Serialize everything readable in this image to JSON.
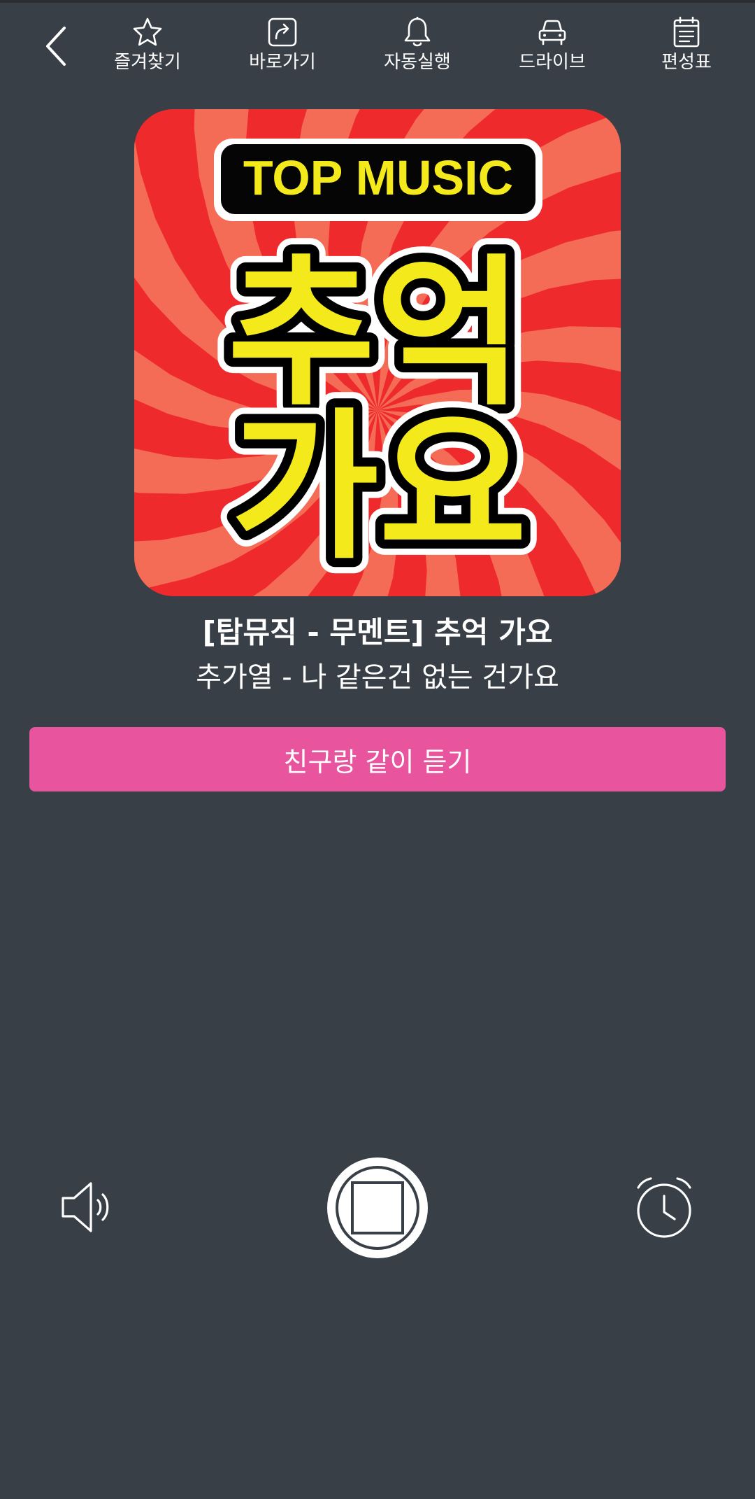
{
  "toolbar": {
    "back_icon": "chevron-left-icon",
    "items": [
      {
        "label": "즐겨찾기",
        "icon": "star-icon"
      },
      {
        "label": "바로가기",
        "icon": "share-arrow-icon"
      },
      {
        "label": "자동실행",
        "icon": "bell-icon"
      },
      {
        "label": "드라이브",
        "icon": "car-icon"
      },
      {
        "label": "편성표",
        "icon": "calendar-list-icon"
      }
    ]
  },
  "album": {
    "badge_text": "TOP MUSIC",
    "line1": "추억",
    "line2": "가요",
    "colors": {
      "red": "#ee2a2c",
      "salmon": "#f4775e",
      "yellow": "#f4ea1b"
    }
  },
  "now_playing": {
    "program_title": "[탑뮤직 - 무멘트] 추억 가요",
    "song_title": "추가열 - 나 같은건 없는 건가요"
  },
  "listen_together_label": "친구랑 같이 듣기",
  "controls": {
    "volume_icon": "speaker-icon",
    "stop_icon": "stop-icon",
    "timer_icon": "alarm-clock-icon"
  },
  "colors": {
    "background": "#393f47",
    "accent": "#e8559e"
  }
}
